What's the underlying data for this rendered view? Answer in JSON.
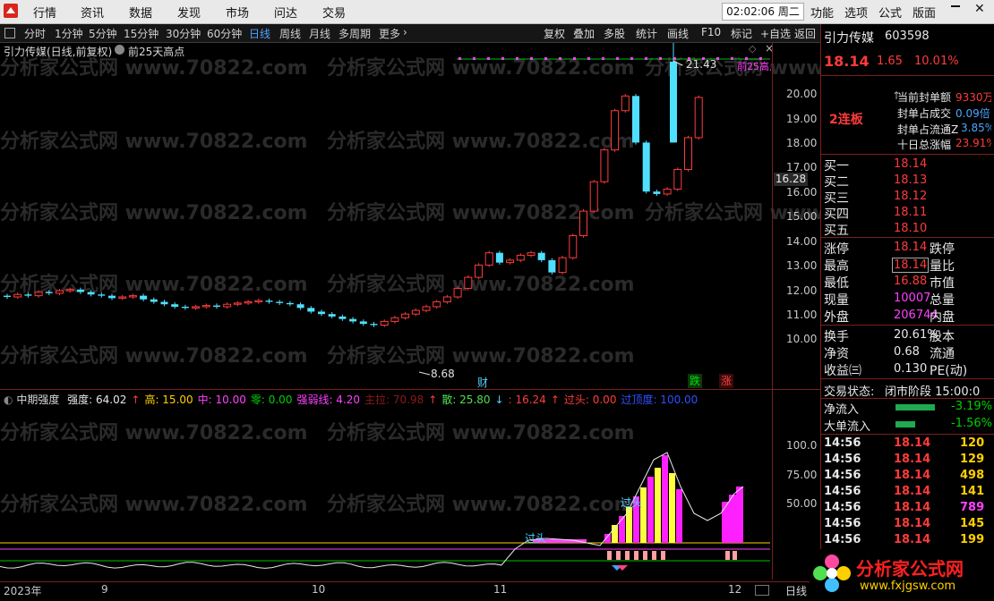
{
  "menu": {
    "items": [
      "行情",
      "资讯",
      "数据",
      "发现",
      "市场",
      "问达",
      "交易"
    ],
    "clock": "02:02:06 周二",
    "right_items": [
      "功能",
      "选项",
      "公式",
      "版面"
    ]
  },
  "toolbar": {
    "periods": [
      "分时",
      "1分钟",
      "5分钟",
      "15分钟",
      "30分钟",
      "60分钟",
      "日线",
      "周线",
      "月线",
      "多周期",
      "更多"
    ],
    "active": "日线",
    "buttons": [
      "复权",
      "叠加",
      "多股",
      "统计",
      "画线",
      "F10",
      "标记",
      "+自选",
      "返回"
    ]
  },
  "chart_header": {
    "title": "引力传媒(日线,前复权)",
    "indicator": "前25天高点"
  },
  "watermark": "分析家公式网 www.70822.com",
  "price_axis": [
    "20.00",
    "19.00",
    "18.00",
    "17.00",
    "16.00",
    "15.00",
    "14.00",
    "13.00",
    "12.00",
    "11.00",
    "10.00"
  ],
  "price_cursor": "16.28",
  "annotations": {
    "high": "21.43",
    "low": "8.68",
    "high_label": "前25高点",
    "cai": "财",
    "die": "跌",
    "zhang": "涨",
    "guotou1": "过头",
    "guotou2": "过头"
  },
  "indicator_bar": {
    "name": "中期强度",
    "items": [
      {
        "label": "强度: 64.02",
        "color": "#e8e8e8"
      },
      {
        "label": "↑",
        "color": "#ff3b3b"
      },
      {
        "label": "高: 15.00",
        "color": "#ffd000"
      },
      {
        "label": "中: 10.00",
        "color": "#ff40ff"
      },
      {
        "label": "零: 0.00",
        "color": "#00d000"
      },
      {
        "label": "强弱线: 4.20",
        "color": "#ff40ff"
      },
      {
        "label": "主拉: 70.98",
        "color": "#8b1a1a"
      },
      {
        "label": "↑",
        "color": "#ff3b3b"
      },
      {
        "label": "散: 25.80",
        "color": "#50e050"
      },
      {
        "label": "↓",
        "color": "#50d0ff"
      },
      {
        "label": ": 16.24",
        "color": "#ff3b3b"
      },
      {
        "label": "↑",
        "color": "#ff3b3b"
      },
      {
        "label": "过头: 0.00",
        "color": "#ff3b3b"
      },
      {
        "label": "过顶度: 100.00",
        "color": "#3050ff"
      }
    ]
  },
  "ind_axis": [
    "100.0",
    "75.00",
    "50.00"
  ],
  "date_axis": [
    "2023年",
    "9",
    "10",
    "11",
    "12"
  ],
  "date_period": "日线",
  "stock": {
    "name": "引力传媒",
    "code": "603598",
    "price": "18.14",
    "change": "1.65",
    "pct": "10.01%",
    "board": "2连板",
    "seal": [
      {
        "label": "当前封单额",
        "value": "9330万"
      },
      {
        "label": "封单占成交",
        "value": "0.09倍"
      },
      {
        "label": "封单占流通Z",
        "value": "3.85%"
      },
      {
        "label": "十日总涨幅",
        "value": "23.91%"
      }
    ],
    "bids": [
      {
        "label": "买一",
        "price": "18.14"
      },
      {
        "label": "买二",
        "price": "18.13"
      },
      {
        "label": "买三",
        "price": "18.12"
      },
      {
        "label": "买四",
        "price": "18.11"
      },
      {
        "label": "买五",
        "price": "18.10"
      }
    ],
    "quote": [
      {
        "l1": "涨停",
        "v1": "18.14",
        "l2": "跌停"
      },
      {
        "l1": "最高",
        "v1": "18.14",
        "l2": "量比"
      },
      {
        "l1": "最低",
        "v1": "16.88",
        "l2": "市值"
      },
      {
        "l1": "现量",
        "v1": "10007",
        "l2": "总量"
      },
      {
        "l1": "外盘",
        "v1": "206744",
        "l2": "内盘"
      }
    ],
    "fin": [
      {
        "l1": "换手",
        "v1": "20.61%",
        "l2": "股本"
      },
      {
        "l1": "净资",
        "v1": "0.68",
        "l2": "流通"
      },
      {
        "l1": "收益㈢",
        "v1": "0.130",
        "l2": "PE(动)"
      }
    ],
    "status_label": "交易状态:",
    "status_value": "闭市阶段 15:00:0",
    "flow": [
      {
        "label": "净流入",
        "value": "-3.19%"
      },
      {
        "label": "大单流入",
        "value": "-1.56%"
      }
    ],
    "ticks": [
      {
        "t": "14:56",
        "p": "18.14",
        "v": "120"
      },
      {
        "t": "14:56",
        "p": "18.14",
        "v": "129"
      },
      {
        "t": "14:56",
        "p": "18.14",
        "v": "498"
      },
      {
        "t": "14:56",
        "p": "18.14",
        "v": "141"
      },
      {
        "t": "14:56",
        "p": "18.14",
        "v": "789"
      },
      {
        "t": "14:56",
        "p": "18.14",
        "v": "145"
      },
      {
        "t": "14:56",
        "p": "18.14",
        "v": "199"
      }
    ]
  },
  "logo": {
    "text": "分析家公式网",
    "url": "www.fxjgsw.com"
  }
}
